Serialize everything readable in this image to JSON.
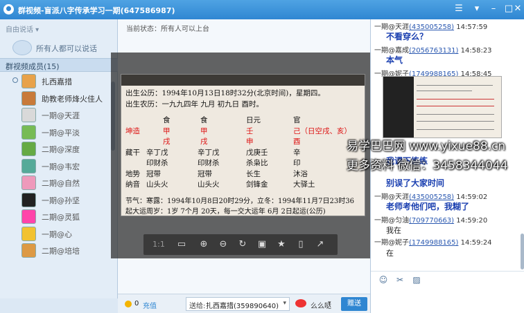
{
  "window": {
    "title": "群视频-盲派八字传承学习一期(647586987)"
  },
  "left": {
    "speak_mode": "自由说话",
    "speak_option": "所有人都可以说话",
    "members_header": "群视频成员(15)",
    "members": [
      {
        "name": "扎西嘉措",
        "color": "#e8a24a"
      },
      {
        "name": "助教老师烽火佳人",
        "color": "#c87a3a"
      },
      {
        "name": "一期@天涯",
        "color": "#d9d9d9"
      },
      {
        "name": "一期@平淡",
        "color": "#7b5"
      },
      {
        "name": "二期@深度",
        "color": "#6a4"
      },
      {
        "name": "一期@韦宏",
        "color": "#5a9"
      },
      {
        "name": "二期@自然",
        "color": "#e9b"
      },
      {
        "name": "一期@孙坚",
        "color": "#222"
      },
      {
        "name": "二期@灵狐",
        "color": "#f4a"
      },
      {
        "name": "一期@心",
        "color": "#f2c230"
      },
      {
        "name": "二期@培培",
        "color": "#d94"
      }
    ]
  },
  "center": {
    "status": "当前状态：所有人可以上台",
    "doc_lines": [
      "出生公历：1994年10月13日18时32分(北京时间)，星期四。",
      "出生农历：一九九四年 九月 初九日 酉时。"
    ],
    "pillars": {
      "heads": [
        "食",
        "食",
        "日元",
        "官"
      ],
      "label_qian": "坤造",
      "tiangan": [
        "甲",
        "甲",
        "壬",
        "己（日空戌、亥）"
      ],
      "dizhi": [
        "戌",
        "戌",
        "申",
        "酉"
      ],
      "zanggan_label": "藏干",
      "zanggan": [
        "辛丁戊",
        "辛丁戊",
        "戊庚壬",
        "辛"
      ],
      "zanggan2": [
        "印财杀",
        "印财杀",
        "杀枭比",
        "印"
      ],
      "dishi_label": "地势",
      "dishi": [
        "冠带",
        "冠带",
        "长生",
        "沐浴"
      ],
      "nayin_label": "纳音",
      "nayin": [
        "山头火",
        "山头火",
        "剑锋金",
        "大驿土"
      ]
    },
    "doc_tail": [
      "节气：寒露：1994年10月8日20时29分，立冬：1994年11月7日23时36",
      "起大运周岁：1岁 7个月 20天，每一交大运年 6月 2日起运(公历)"
    ],
    "viewer_tools": [
      "1:1",
      "fit-icon",
      "zoom-in-icon",
      "zoom-out-icon",
      "rotate-icon",
      "save-icon",
      "bookmark-icon",
      "screen-icon",
      "share-icon"
    ],
    "coins_value": "0",
    "coins_label": "充值",
    "sendto_label": "送给:",
    "sendto_name": "扎西嘉措(359890640)",
    "gift_label": "么么哒",
    "give_label": "赠送"
  },
  "chat": {
    "messages": [
      {
        "sender": "一期@天涯",
        "qq": "(435005258)",
        "time": "14:57:59",
        "text": "不看穿么？"
      },
      {
        "sender": "一期@嘉成",
        "qq": "(2056763131)",
        "time": "14:58:23",
        "text": "本气"
      },
      {
        "sender": "一期@妮子",
        "qq": "(1749988165)",
        "time": "14:58:45",
        "text": ""
      },
      {
        "sender": "",
        "qq": "",
        "time": "",
        "text": "我课下练练"
      },
      {
        "sender": "",
        "qq": "",
        "time": "",
        "text": "别误了大家时间"
      },
      {
        "sender": "一期@天涯",
        "qq": "(435005258)",
        "time": "14:59:02",
        "text": "老师考他们吧，我糊了"
      },
      {
        "sender": "一期@匀油",
        "qq": "(709770663)",
        "time": "14:59:20",
        "text": "我在"
      },
      {
        "sender": "一期@妮子",
        "qq": "(1749988165)",
        "time": "14:59:24",
        "text": "在"
      }
    ]
  },
  "watermark": {
    "line1": "易学巴巴网 www.yixue88.cn",
    "line2": "更多资料 微信：3458344044"
  }
}
